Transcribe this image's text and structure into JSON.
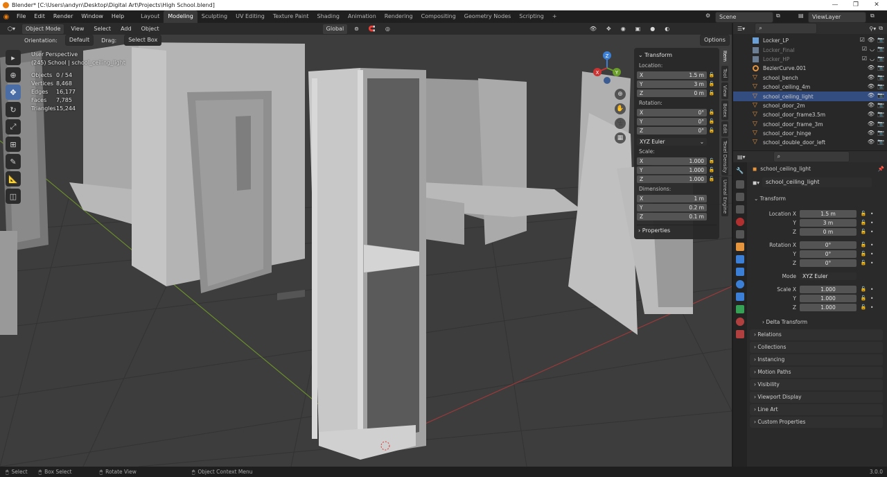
{
  "window": {
    "title": "Blender* [C:\\Users\\andyn\\Desktop\\Digital Art\\Projects\\High School.blend]"
  },
  "menus": [
    "File",
    "Edit",
    "Render",
    "Window",
    "Help"
  ],
  "workspaces": [
    "Layout",
    "Modeling",
    "Sculpting",
    "UV Editing",
    "Texture Paint",
    "Shading",
    "Animation",
    "Rendering",
    "Compositing",
    "Geometry Nodes",
    "Scripting"
  ],
  "active_workspace": "Modeling",
  "scene": {
    "name": "Scene",
    "view_layer": "ViewLayer"
  },
  "viewport_header": {
    "mode": "Object Mode",
    "menus": [
      "View",
      "Select",
      "Add",
      "Object"
    ],
    "transform_orientation": "Global",
    "orientation_label": "Orientation:",
    "orientation_value": "Default",
    "drag_label": "Drag:",
    "drag_value": "Select Box",
    "options": "Options"
  },
  "overlay": {
    "view": "User Perspective",
    "context": "(245) School | school_ceiling_light",
    "stats": [
      {
        "label": "Objects",
        "value": "0 / 54"
      },
      {
        "label": "Vertices",
        "value": "8,468"
      },
      {
        "label": "Edges",
        "value": "16,177"
      },
      {
        "label": "Faces",
        "value": "7,785"
      },
      {
        "label": "Triangles",
        "value": "15,244"
      }
    ]
  },
  "gizmo": {
    "x": "X",
    "y": "Y",
    "z": "Z"
  },
  "npanel": {
    "title": "Transform",
    "location_label": "Location:",
    "location": [
      {
        "axis": "X",
        "value": "1.5 m"
      },
      {
        "axis": "Y",
        "value": "3 m"
      },
      {
        "axis": "Z",
        "value": "0 m"
      }
    ],
    "rotation_label": "Rotation:",
    "rotation": [
      {
        "axis": "X",
        "value": "0°"
      },
      {
        "axis": "Y",
        "value": "0°"
      },
      {
        "axis": "Z",
        "value": "0°"
      }
    ],
    "rotation_mode": "XYZ Euler",
    "scale_label": "Scale:",
    "scale": [
      {
        "axis": "X",
        "value": "1.000"
      },
      {
        "axis": "Y",
        "value": "1.000"
      },
      {
        "axis": "Z",
        "value": "1.000"
      }
    ],
    "dimensions_label": "Dimensions:",
    "dimensions": [
      {
        "axis": "X",
        "value": "1 m"
      },
      {
        "axis": "Y",
        "value": "0.2 m"
      },
      {
        "axis": "Z",
        "value": "0.1 m"
      }
    ],
    "properties": "Properties",
    "tabs": [
      "Item",
      "Tool",
      "View",
      "Botex",
      "Edit",
      "Texel Density",
      "Unreal Engine"
    ]
  },
  "outliner": {
    "items": [
      {
        "name": "Locker_LP",
        "dim": false
      },
      {
        "name": "Locker_Final",
        "dim": true
      },
      {
        "name": "Locker_HP",
        "dim": true
      },
      {
        "name": "BezierCurve.001",
        "dim": false
      },
      {
        "name": "school_bench",
        "dim": false
      },
      {
        "name": "school_ceiling_4m",
        "dim": false
      },
      {
        "name": "school_ceiling_light",
        "dim": false
      },
      {
        "name": "school_door_2m",
        "dim": false
      },
      {
        "name": "school_door_frame3.5m",
        "dim": false
      },
      {
        "name": "school_door_frame_3m",
        "dim": false
      },
      {
        "name": "school_door_hinge",
        "dim": false
      },
      {
        "name": "school_double_door_left",
        "dim": false
      }
    ]
  },
  "properties": {
    "object_name": "school_ceiling_light",
    "datablock_name": "school_ceiling_light",
    "transform_header": "Transform",
    "location": [
      {
        "label": "Location X",
        "value": "1.5 m"
      },
      {
        "label": "Y",
        "value": "3 m"
      },
      {
        "label": "Z",
        "value": "0 m"
      }
    ],
    "rotation": [
      {
        "label": "Rotation X",
        "value": "0°"
      },
      {
        "label": "Y",
        "value": "0°"
      },
      {
        "label": "Z",
        "value": "0°"
      }
    ],
    "mode_label": "Mode",
    "mode_value": "XYZ Euler",
    "scale": [
      {
        "label": "Scale X",
        "value": "1.000"
      },
      {
        "label": "Y",
        "value": "1.000"
      },
      {
        "label": "Z",
        "value": "1.000"
      }
    ],
    "sections": [
      "Delta Transform",
      "Relations",
      "Collections",
      "Instancing",
      "Motion Paths",
      "Visibility",
      "Viewport Display",
      "Line Art",
      "Custom Properties"
    ]
  },
  "statusbar": {
    "select": "Select",
    "box_select": "Box Select",
    "rotate_view": "Rotate View",
    "context_menu": "Object Context Menu",
    "version": "3.0.0"
  }
}
